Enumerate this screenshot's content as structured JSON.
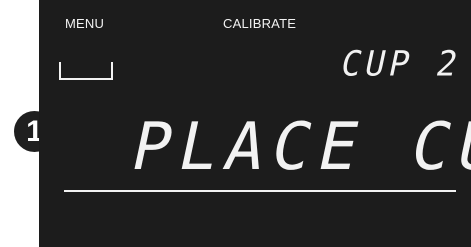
{
  "callout": {
    "number": "1"
  },
  "screen": {
    "menu_label": "MENU",
    "title": "CALIBRATE",
    "cup_indicator": "CUP 2",
    "message": "PLACE CUP"
  },
  "icons": {
    "menu_softkey": "empty-softkey-bracket-icon"
  },
  "colors": {
    "screen_background": "#1c1c1c",
    "screen_text": "#f2f2f2",
    "callout_background": "#1f1f1f"
  }
}
